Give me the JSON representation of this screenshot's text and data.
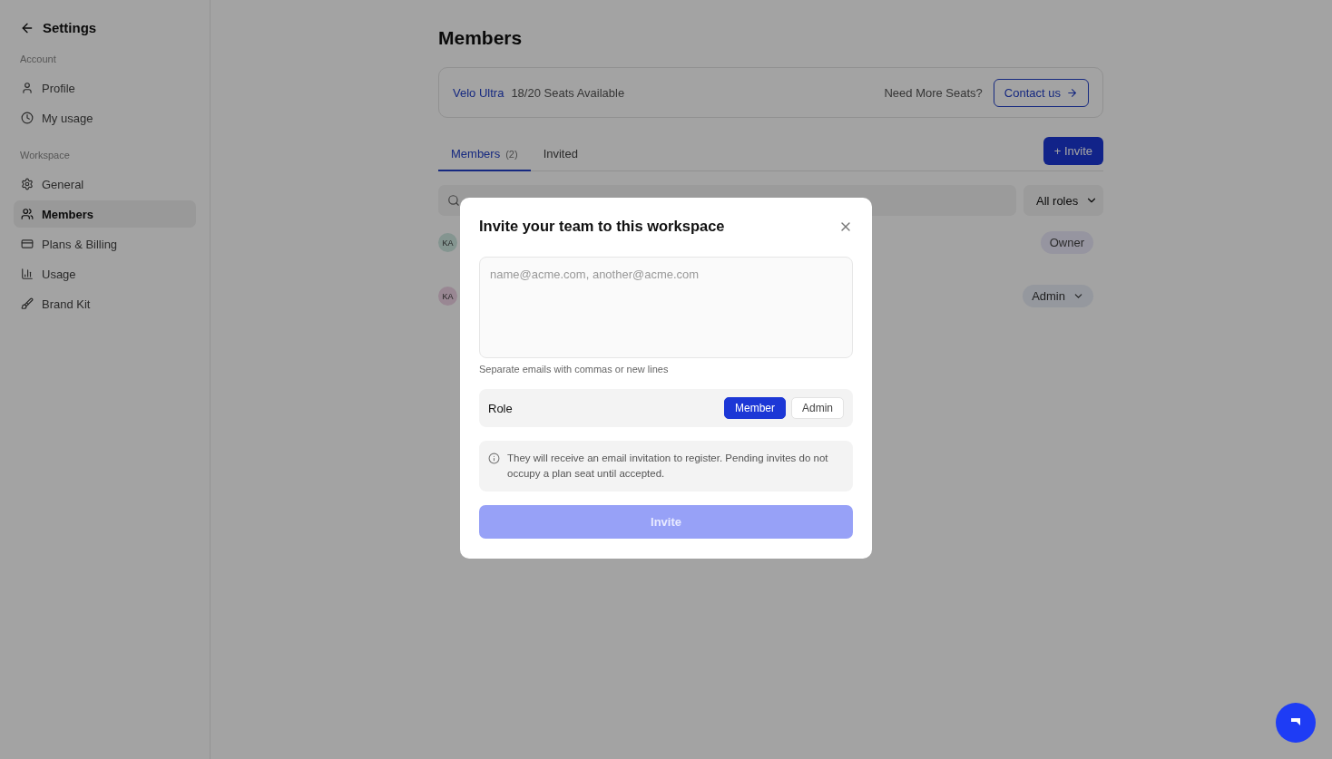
{
  "sidebar": {
    "title": "Settings",
    "sections": [
      {
        "heading": "Account",
        "items": [
          {
            "label": "Profile",
            "selected": false
          },
          {
            "label": "My usage",
            "selected": false
          }
        ]
      },
      {
        "heading": "Workspace",
        "items": [
          {
            "label": "General",
            "selected": false
          },
          {
            "label": "Members",
            "selected": true
          },
          {
            "label": "Plans & Billing",
            "selected": false
          },
          {
            "label": "Usage",
            "selected": false
          },
          {
            "label": "Brand Kit",
            "selected": false
          }
        ]
      }
    ]
  },
  "page": {
    "title": "Members",
    "plan": {
      "name": "Velo Ultra",
      "seats": "18/20 Seats Available",
      "prompt": "Need More Seats?",
      "contact": "Contact us"
    },
    "tabs": [
      {
        "label": "Members",
        "count": "(2)",
        "selected": true
      },
      {
        "label": "Invited",
        "selected": false
      }
    ],
    "invite_button": "+ Invite",
    "filter": "All roles",
    "members": [
      {
        "initials": "KA",
        "role": "Owner",
        "kind": "badge"
      },
      {
        "initials": "KA",
        "role": "Admin",
        "kind": "dropdown"
      }
    ]
  },
  "dialog": {
    "title": "Invite your team to this workspace",
    "placeholder": "name@acme.com, another@acme.com",
    "hint": "Separate emails with commas or new lines",
    "role_label": "Role",
    "roles": [
      {
        "label": "Member",
        "selected": true
      },
      {
        "label": "Admin",
        "selected": false
      }
    ],
    "note": "They will receive an email invitation to register. Pending invites do not occupy a plan seat until accepted.",
    "submit": {
      "label": "Invite",
      "disabled": true
    }
  }
}
